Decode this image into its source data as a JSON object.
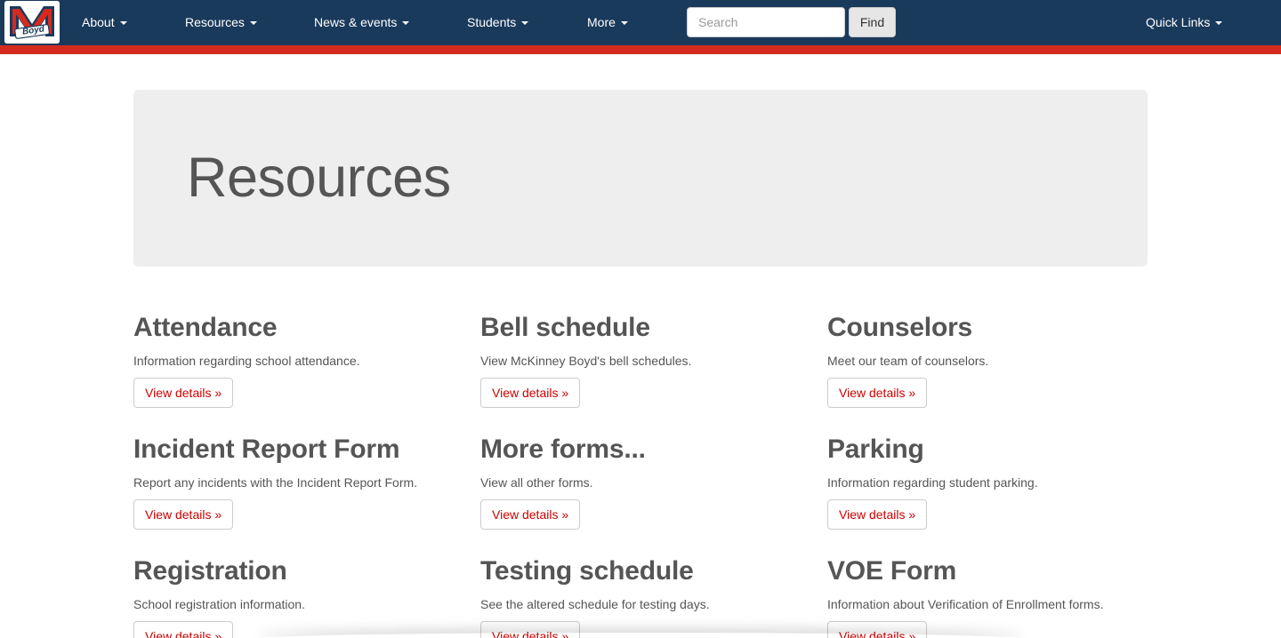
{
  "nav": {
    "logo_icon": "mckinney-boyd-logo",
    "logo_text": "Boyd",
    "menu": [
      {
        "label": "About"
      },
      {
        "label": "Resources"
      },
      {
        "label": "News & events"
      },
      {
        "label": "Students"
      },
      {
        "label": "More"
      }
    ],
    "search_placeholder": "Search",
    "search_value": "",
    "find_label": "Find",
    "quick_links_label": "Quick Links",
    "colors": {
      "bar": "#1a3a5c",
      "stripe": "#d52b1e",
      "link": "#cc0000"
    }
  },
  "page": {
    "title": "Resources"
  },
  "resources": [
    {
      "title": "Attendance",
      "description": "Information regarding school attendance.",
      "button": "View details »"
    },
    {
      "title": "Bell schedule",
      "description": "View McKinney Boyd's bell schedules.",
      "button": "View details »"
    },
    {
      "title": "Counselors",
      "description": "Meet our team of counselors.",
      "button": "View details »"
    },
    {
      "title": "Incident Report Form",
      "description": "Report any incidents with the Incident Report Form.",
      "button": "View details »"
    },
    {
      "title": "More forms...",
      "description": "View all other forms.",
      "button": "View details »"
    },
    {
      "title": "Parking",
      "description": "Information regarding student parking.",
      "button": "View details »"
    },
    {
      "title": "Registration",
      "description": "School registration information.",
      "button": "View details »"
    },
    {
      "title": "Testing schedule",
      "description": "See the altered schedule for testing days.",
      "button": "View details »"
    },
    {
      "title": "VOE Form",
      "description": "Information about Verification of Enrollment forms.",
      "button": "View details »"
    }
  ]
}
